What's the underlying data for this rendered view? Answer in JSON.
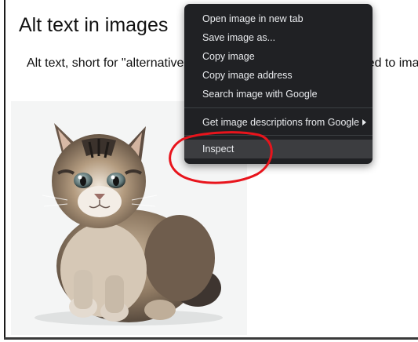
{
  "article": {
    "heading": "Alt text in images",
    "paragraph": "Alt text, short for \"alternative text,\" is a textual description added to images, providing a written representation of their content."
  },
  "image": {
    "icon": "kitten-photo"
  },
  "context_menu": {
    "items": [
      {
        "label": "Open image in new tab"
      },
      {
        "label": "Save image as..."
      },
      {
        "label": "Copy image"
      },
      {
        "label": "Copy image address"
      },
      {
        "label": "Search image with Google"
      },
      {
        "label": "Get image descriptions from Google"
      },
      {
        "label": "Inspect"
      }
    ],
    "colors": {
      "background": "#202124",
      "hover": "#3c3d40",
      "text": "#e8eaed"
    }
  },
  "annotation": {
    "color": "#e8141c"
  }
}
